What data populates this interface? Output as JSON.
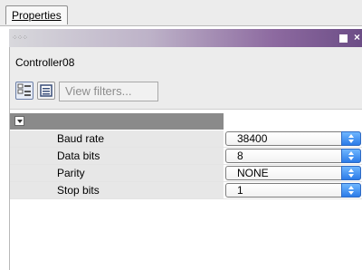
{
  "tab": {
    "label": "Properties"
  },
  "panel": {
    "grip": "⁘⁘⁘"
  },
  "object": {
    "name": "Controller08"
  },
  "toolbar": {
    "filter_placeholder": "View filters..."
  },
  "properties": [
    {
      "label": "Baud rate",
      "value": "38400"
    },
    {
      "label": "Data bits",
      "value": "8"
    },
    {
      "label": "Parity",
      "value": "NONE"
    },
    {
      "label": "Stop bits",
      "value": "1"
    }
  ]
}
